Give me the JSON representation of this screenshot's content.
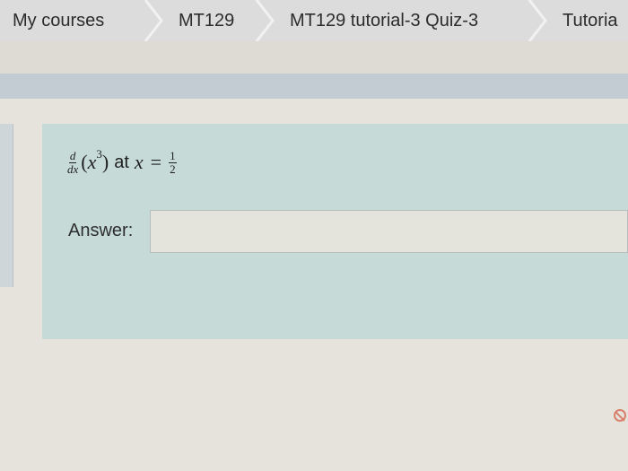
{
  "breadcrumb": {
    "items": [
      {
        "label": "My courses"
      },
      {
        "label": "MT129"
      },
      {
        "label": "MT129 tutorial-3 Quiz-3"
      },
      {
        "label": "Tutoria"
      }
    ]
  },
  "question": {
    "derivative_numerator": "d",
    "derivative_denominator": "dx",
    "open_paren": "(",
    "base_var": "x",
    "exponent": "3",
    "close_paren": ")",
    "word_at": "at",
    "at_var": "x",
    "equals": "=",
    "value_numerator": "1",
    "value_denominator": "2"
  },
  "answer": {
    "label": "Answer:",
    "value": "",
    "placeholder": ""
  },
  "colors": {
    "question_bg": "#c6dbd8",
    "breadcrumb_bg": "#dcdcdc",
    "flag_icon": "#d9806c"
  },
  "icons": {
    "corner": "flag-icon"
  }
}
